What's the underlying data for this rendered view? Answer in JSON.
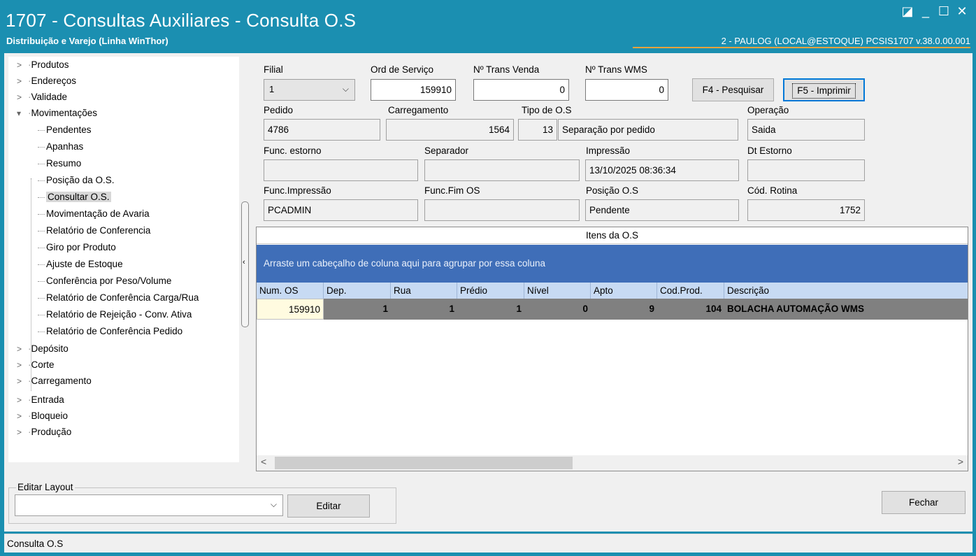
{
  "window": {
    "title": "1707 - Consultas Auxiliares - Consulta O.S",
    "subtitle": "Distribuição e Varejo (Linha WinThor)",
    "right_info": "2 - PAULOG (LOCAL@ESTOQUE)   PCSIS1707  v.38.0.00.001"
  },
  "tree": {
    "top_items": [
      "Produtos",
      "Endereços",
      "Validade"
    ],
    "expanded": "Movimentações",
    "children": [
      "Pendentes",
      "Apanhas",
      "Resumo",
      "Posição da O.S.",
      "Consultar O.S.",
      "Movimentação de Avaria",
      "Relatório de Conferencia",
      "Giro por Produto",
      "Ajuste de Estoque",
      "Conferência por Peso/Volume",
      "Relatório de Conferência Carga/Rua",
      "Relatório de Rejeição - Conv. Ativa",
      "Relatório de Conferência Pedido"
    ],
    "bottom_items": [
      "Depósito",
      "Corte",
      "Carregamento",
      "Entrada",
      "Bloqueio",
      "Produção"
    ],
    "selected": "Consultar O.S."
  },
  "form": {
    "filial_label": "Filial",
    "filial_value": "1",
    "ord_label": "Ord de Serviço",
    "ord_value": "159910",
    "trans_venda_label": "Nº Trans Venda",
    "trans_venda_value": "0",
    "trans_wms_label": "Nº Trans WMS",
    "trans_wms_value": "0",
    "btn_pesquisar": "F4 - Pesquisar",
    "btn_imprimir": "F5 - Imprimir",
    "pedido_label": "Pedido",
    "pedido_value": "4786",
    "carregamento_label": "Carregamento",
    "carregamento_value": "1564",
    "tipo_label": "Tipo de O.S",
    "tipo_code": "13",
    "tipo_desc": "Separação por pedido",
    "operacao_label": "Operação",
    "operacao_value": "Saida",
    "func_estorno_label": "Func. estorno",
    "func_estorno_value": "",
    "separador_label": "Separador",
    "separador_value": "",
    "impressao_label": "Impressão",
    "impressao_value": "13/10/2025 08:36:34",
    "dt_estorno_label": "Dt Estorno",
    "dt_estorno_value": "",
    "func_impressao_label": "Func.Impressão",
    "func_impressao_value": "PCADMIN",
    "func_fim_label": "Func.Fim OS",
    "func_fim_value": "",
    "posicao_label": "Posição O.S",
    "posicao_value": "Pendente",
    "cod_rotina_label": "Cód. Rotina",
    "cod_rotina_value": "1752"
  },
  "grid": {
    "title": "Itens da O.S",
    "group_hint": "Arraste um cabeçalho de coluna aqui para agrupar por essa coluna",
    "columns": [
      "Num. OS",
      "Dep.",
      "Rua",
      "Prédio",
      "Nível",
      "Apto",
      "Cod.Prod.",
      "Descrição"
    ],
    "rows": [
      [
        "159910",
        "1",
        "1",
        "1",
        "0",
        "9",
        "104",
        "BOLACHA AUTOMAÇÃO WMS"
      ]
    ]
  },
  "layout": {
    "legend": "Editar Layout",
    "combo_value": "",
    "edit_button": "Editar"
  },
  "fechar_button": "Fechar",
  "status": "Consulta O.S"
}
